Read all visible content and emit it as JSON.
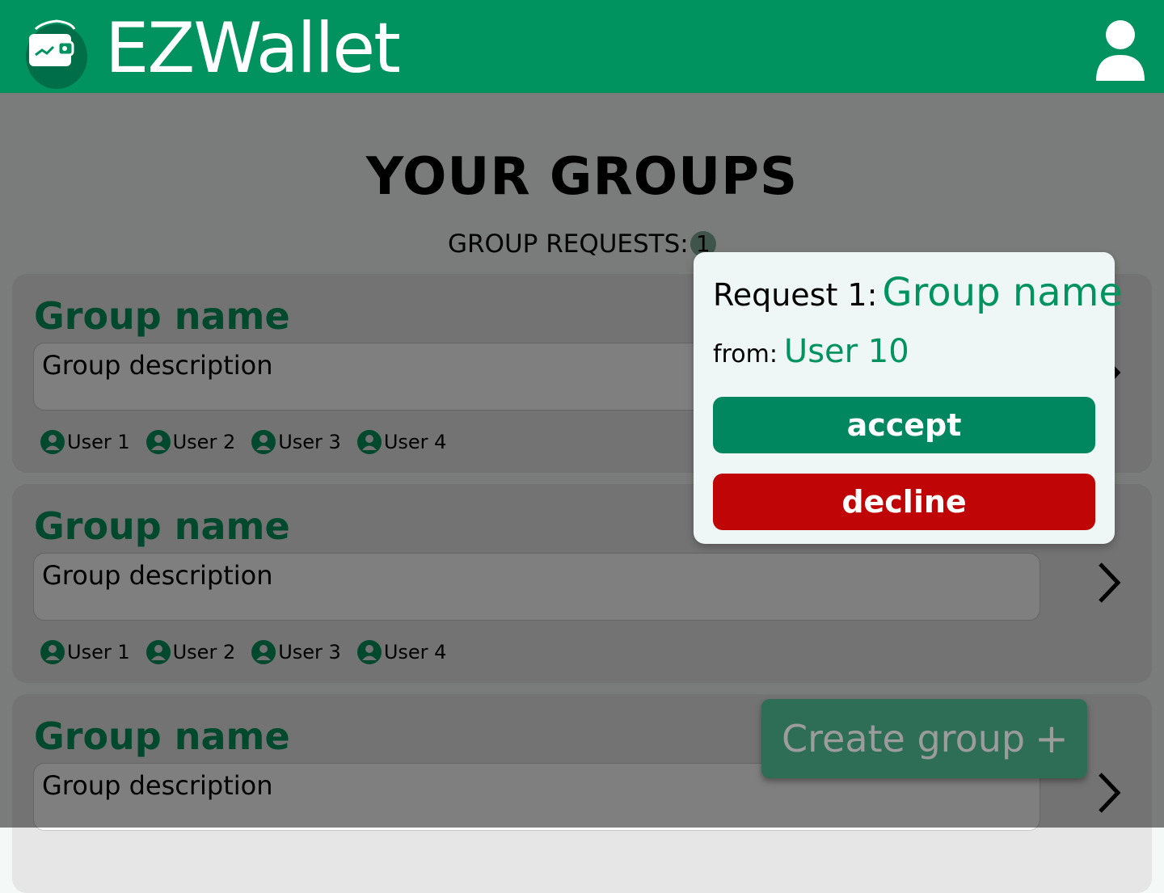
{
  "header": {
    "brand": "EZWallet",
    "colors": {
      "bar": "#00935f",
      "brand_text": "#ffffff"
    }
  },
  "main": {
    "title": "YOUR GROUPS",
    "requests_label": "GROUP REQUESTS:",
    "requests_count": "1",
    "groups": [
      {
        "name": "Group name",
        "description": "Group description",
        "members": [
          "User 1",
          "User 2",
          "User 3",
          "User 4"
        ]
      },
      {
        "name": "Group name",
        "description": "Group description",
        "members": [
          "User 1",
          "User 2",
          "User 3",
          "User 4"
        ]
      },
      {
        "name": "Group name",
        "description": "Group description"
      }
    ]
  },
  "popup": {
    "request_label": "Request 1:",
    "group_name": "Group name",
    "from_label": "from:",
    "from_user": "User 10",
    "accept_label": "accept",
    "decline_label": "decline"
  },
  "create_button": {
    "label": "Create group",
    "plus": "+"
  },
  "theme": {
    "accent": "#00935f",
    "accept": "#00875f",
    "decline": "#bf0505"
  }
}
